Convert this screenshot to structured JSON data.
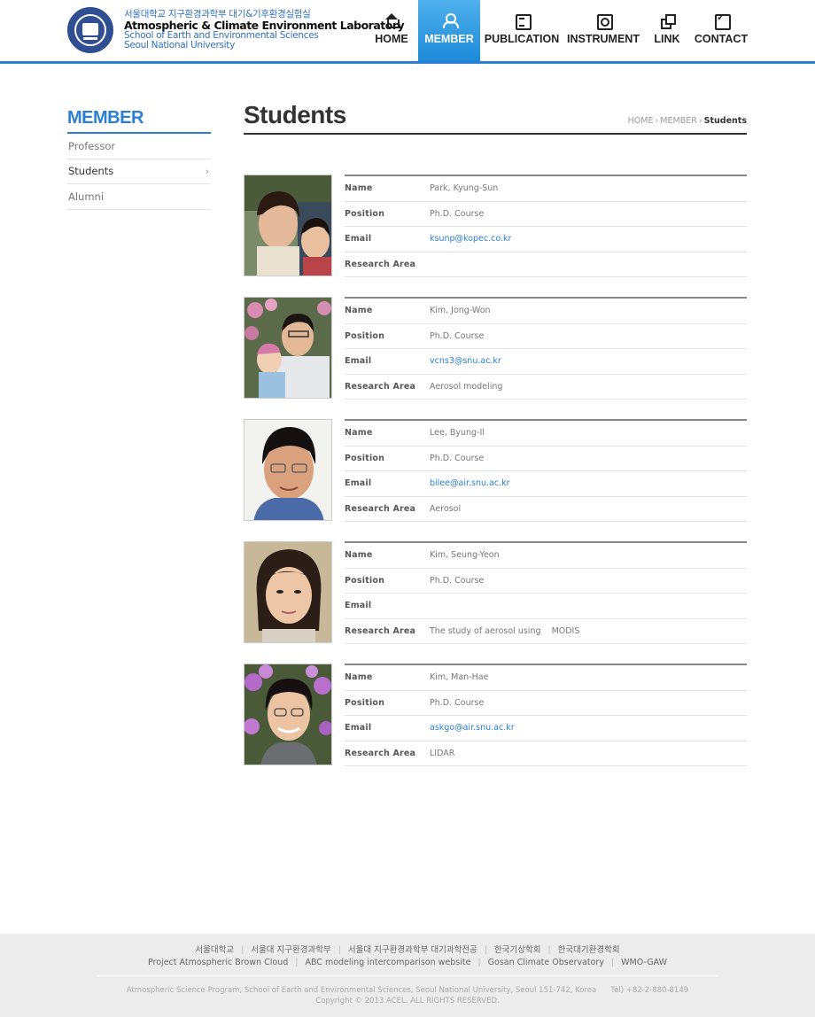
{
  "header": {
    "logo_line1": "서울대학교 지구환경과학부 대기&기후환경실험실",
    "logo_line2": "Atmospheric & Climate Environment Laboratory",
    "logo_line3": "School of Earth and Environmental Sciences",
    "logo_line4": "Seoul National University"
  },
  "nav": {
    "home": "HOME",
    "member": "MEMBER",
    "publication": "PUBLICATION",
    "instrument": "INSTRUMENT",
    "link": "LINK",
    "contact": "CONTACT",
    "active_color": "#1d8ad8"
  },
  "sidebar": {
    "title": "MEMBER",
    "items": [
      {
        "label": "Professor"
      },
      {
        "label": "Students"
      },
      {
        "label": "Alumni"
      }
    ]
  },
  "page": {
    "title": "Students",
    "breadcrumb": {
      "home": "HOME",
      "section": "MEMBER",
      "current": "Students"
    }
  },
  "labels": {
    "name": "Name",
    "position": "Position",
    "email": "Email",
    "research": "Research Area"
  },
  "members": [
    {
      "name": "Park, Kyung-Sun",
      "position": "Ph.D. Course",
      "email": "ksunp@kopec.co.kr",
      "research": ""
    },
    {
      "name": "Kim, Jong-Won",
      "position": "Ph.D. Course",
      "email": "vcns3@snu.ac.kr",
      "research": "Aerosol modeling"
    },
    {
      "name": "Lee, Byung-Il",
      "position": "Ph.D. Course",
      "email": "bilee@air.snu.ac.kr",
      "research": "Aerosol"
    },
    {
      "name": "Kim, Seung-Yeon",
      "position": "Ph.D. Course",
      "email": "",
      "research": "The study of aerosol using    MODIS"
    },
    {
      "name": "Kim, Man-Hae",
      "position": "Ph.D. Course",
      "email": "askgo@air.snu.ac.kr",
      "research": "LIDAR"
    }
  ],
  "footer": {
    "links_row1": [
      "서울대학교",
      "서울대 지구환경과학부",
      "서울대 지구환경과학부 대기과학전공",
      "한국기상학회",
      "한국대기환경학회"
    ],
    "links_row2": [
      "Project Atmospheric Brown Cloud",
      "ABC modeling intercomparison website",
      "Gosan Climate Observatory",
      "WMO-GAW"
    ],
    "address": "Atmospheric Science Program, School of Earth and Environmental Sciences, Seoul National University, Seoul 151-742, Korea      Tel) +82-2-880-8149",
    "copyright": "Copyright © 2013 ACEL. ALL RIGHTS RESERVED."
  }
}
